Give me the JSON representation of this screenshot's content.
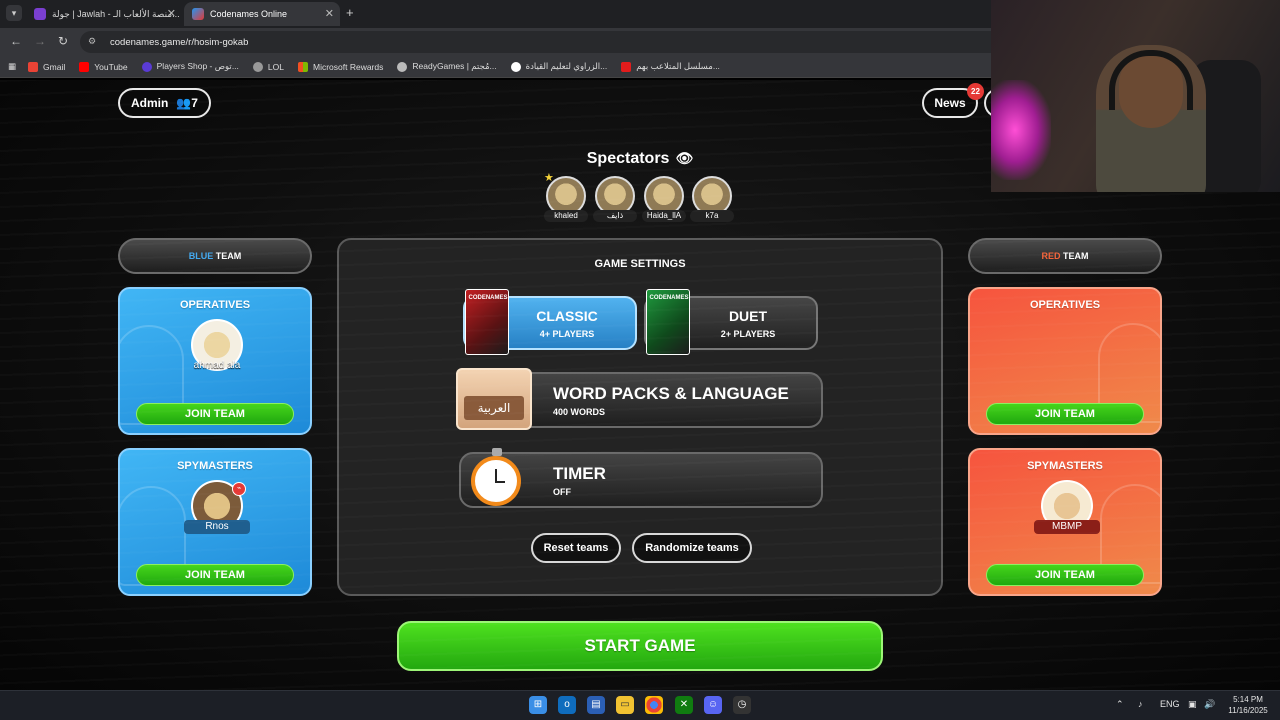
{
  "browser": {
    "tabs": [
      {
        "title": "جولة | Jawlah - منصة الألعاب الـ...",
        "active": false
      },
      {
        "title": "Codenames Online",
        "active": true
      }
    ],
    "url": "codenames.game/r/hosim-gokab",
    "bookmarks": [
      "Gmail",
      "YouTube",
      "Players Shop - توص...",
      "LOL",
      "Microsoft Rewards",
      "ReadyGames | مُجتم...",
      "الزراوي لتعليم القيادة...",
      "مسلسل المتلاعب بهم..."
    ]
  },
  "header": {
    "admin_label": "Admin",
    "player_count": "7",
    "news_label": "News",
    "news_count": "22"
  },
  "spectators": {
    "title": "Spectators",
    "names": [
      "khaled",
      "ذايف",
      "Haida_llA",
      "k7a"
    ]
  },
  "blue_team": {
    "label_color_word": "BLUE",
    "label_word": "TEAM",
    "operatives_title": "OPERATIVES",
    "operative_name": "ahmad ala",
    "spymasters_title": "SPYMASTERS",
    "spymaster_name": "Rnos",
    "join_label": "JOIN TEAM",
    "color": "#2a9be6"
  },
  "red_team": {
    "label_color_word": "RED",
    "label_word": "TEAM",
    "operatives_title": "OPERATIVES",
    "spymasters_title": "SPYMASTERS",
    "spymaster_name": "MBMP",
    "join_label": "JOIN TEAM",
    "color": "#f25a3e"
  },
  "settings": {
    "title": "GAME SETTINGS",
    "modes": [
      {
        "label": "CLASSIC",
        "sub": "4+ PLAYERS",
        "selected": true,
        "box_text": "CODENAMES"
      },
      {
        "label": "DUET",
        "sub": "2+ PLAYERS",
        "selected": false,
        "box_text": "CODENAMES"
      }
    ],
    "word_packs": {
      "label": "WORD PACKS & LANGUAGE",
      "value": "400 WORDS",
      "language_badge": "العربية"
    },
    "timer": {
      "label": "TIMER",
      "value": "OFF"
    },
    "reset_label": "Reset teams",
    "randomize_label": "Randomize teams"
  },
  "start_label": "START GAME",
  "taskbar": {
    "language": "ENG",
    "time": "5:14 PM",
    "date": "11/16/2025"
  }
}
